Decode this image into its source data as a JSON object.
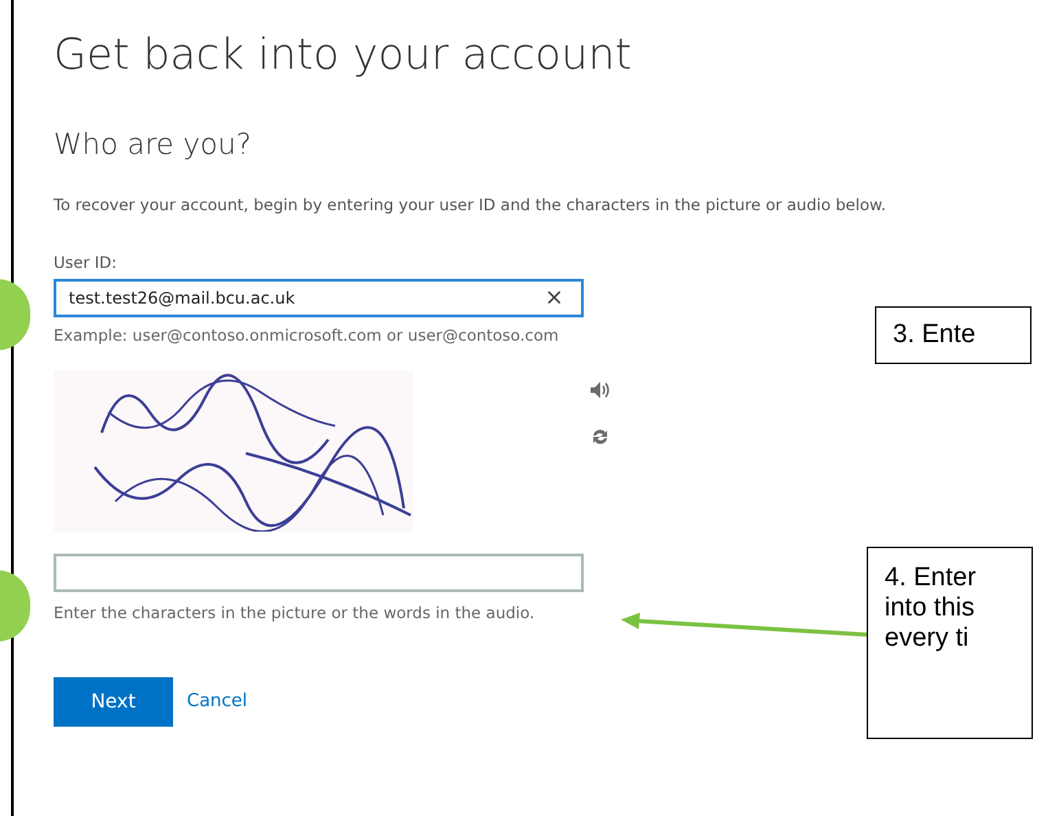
{
  "page": {
    "title": "Get back into your account",
    "subtitle": "Who are you?",
    "instructions": "To recover your account, begin by entering your user ID and the characters in the picture or audio below."
  },
  "user_id": {
    "label": "User ID:",
    "value": "test.test26@mail.bcu.ac.uk",
    "example": "Example: user@contoso.onmicrosoft.com or user@contoso.com"
  },
  "captcha": {
    "hint": "Enter the characters in the picture or the words in the audio."
  },
  "buttons": {
    "next": "Next",
    "cancel": "Cancel"
  },
  "callouts": [
    {
      "lines": [
        "3. Ente"
      ]
    },
    {
      "lines": [
        "4. Enter",
        "into this",
        "every ti"
      ]
    }
  ]
}
